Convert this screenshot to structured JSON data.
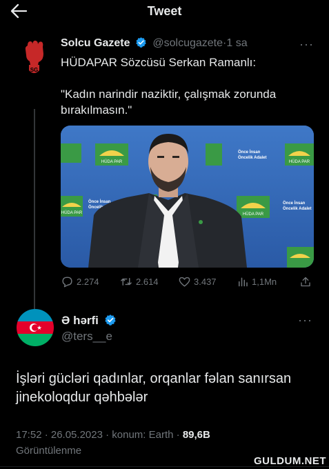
{
  "header": {
    "title": "Tweet",
    "back_icon": "arrow-left-icon"
  },
  "colors": {
    "verified": "#1d9bf0",
    "muted": "#71767b",
    "text": "#e7e9ea",
    "background": "#000000",
    "avatar_red": "#c62828"
  },
  "tweet": {
    "author_name": "Solcu Gazete",
    "author_handle": "@solcugazete",
    "separator": "·",
    "time": "1 sa",
    "text": "HÜDAPAR Sözcüsü Serkan Ramanlı:\n\n\"Kadın narindir naziktir, çalışmak zorunda bırakılmasın.\"",
    "avatar_label": "SG",
    "media": {
      "backdrop_slogan": [
        "Önce İnsan",
        "Öncelik Adalet"
      ],
      "backdrop_logo": "HÜDA PAR"
    },
    "stats": {
      "replies": "2.274",
      "retweets": "2.614",
      "likes": "3.437",
      "views": "1,1Mn"
    }
  },
  "reply": {
    "author_name": "Ə hərfi",
    "author_handle": "@ters__e",
    "text": "İşləri gücləri qadınlar, orqanlar fəlan sanırsan jinekoloqdur qəhbələr",
    "timestamp": "17:52 · 26.05.2023 · konum: Earth · ",
    "views_count": "89,6B",
    "views_label": "Görüntülenme"
  },
  "watermark": "GULDUM.NET"
}
